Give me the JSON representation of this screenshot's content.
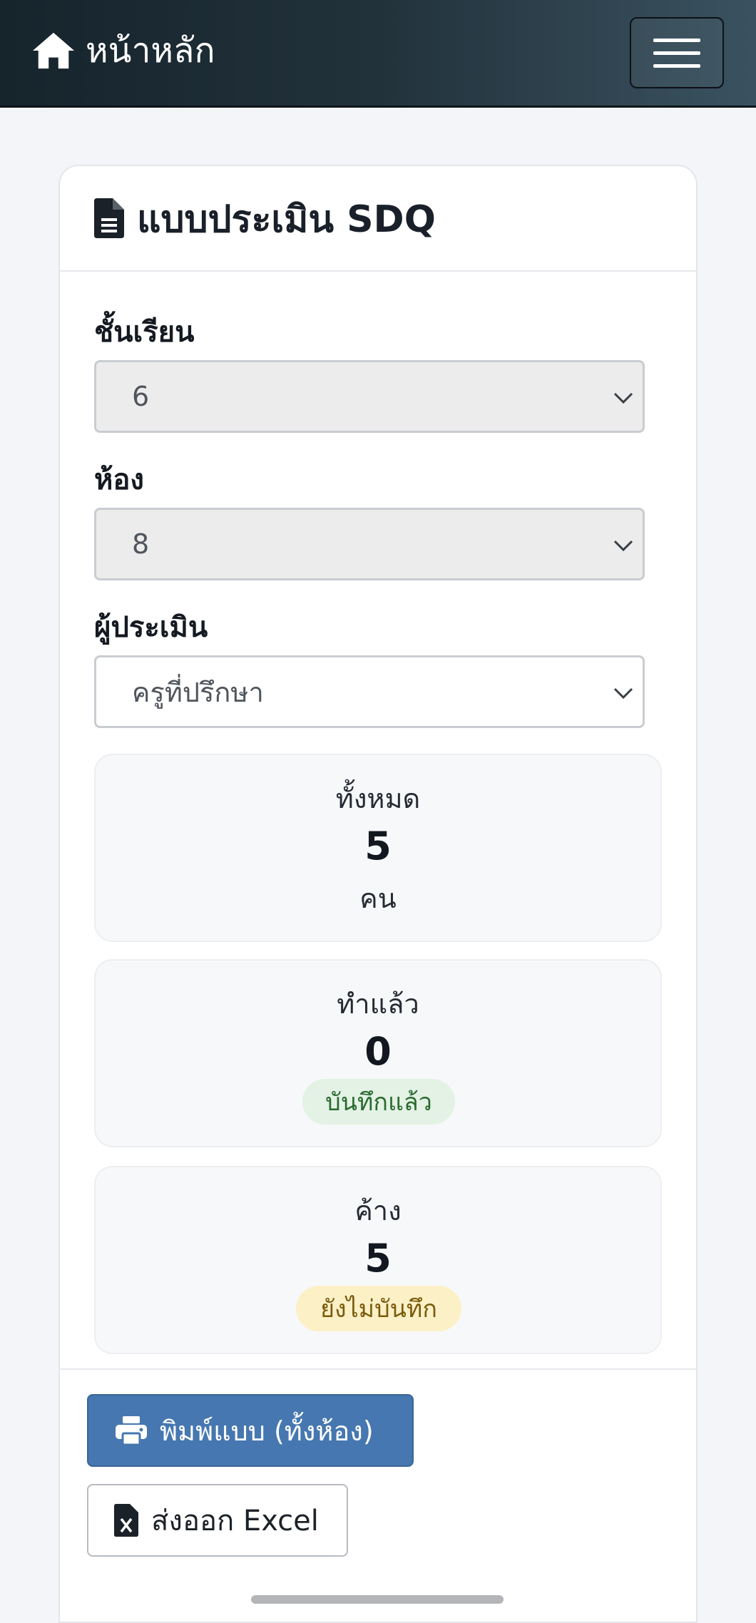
{
  "navbar": {
    "brand_label": "หน้าหลัก",
    "brand_icon": "home-icon",
    "menu_icon": "hamburger-icon"
  },
  "card": {
    "title": "แบบประเมิน SDQ",
    "title_icon": "document-icon"
  },
  "form": {
    "grade_label": "ชั้นเรียน",
    "grade_value": "6",
    "room_label": "ห้อง",
    "room_value": "8",
    "evaluator_label": "ผู้ประเมิน",
    "evaluator_value": "ครูที่ปรึกษา"
  },
  "stats": {
    "total": {
      "label": "ทั้งหมด",
      "value": "5",
      "unit": "คน"
    },
    "done": {
      "label": "ทำแล้ว",
      "value": "0",
      "badge": "บันทึกแล้ว"
    },
    "pending": {
      "label": "ค้าง",
      "value": "5",
      "badge": "ยังไม่บันทึก"
    }
  },
  "actions": {
    "print_label": "พิมพ์แบบ (ทั้งห้อง)",
    "excel_label": "ส่งออก Excel"
  },
  "colors": {
    "primary": "#4677b0",
    "success_bg": "#e3f2e4",
    "warning_bg": "#fcf0c6",
    "navbar_dark": "#16242c"
  }
}
